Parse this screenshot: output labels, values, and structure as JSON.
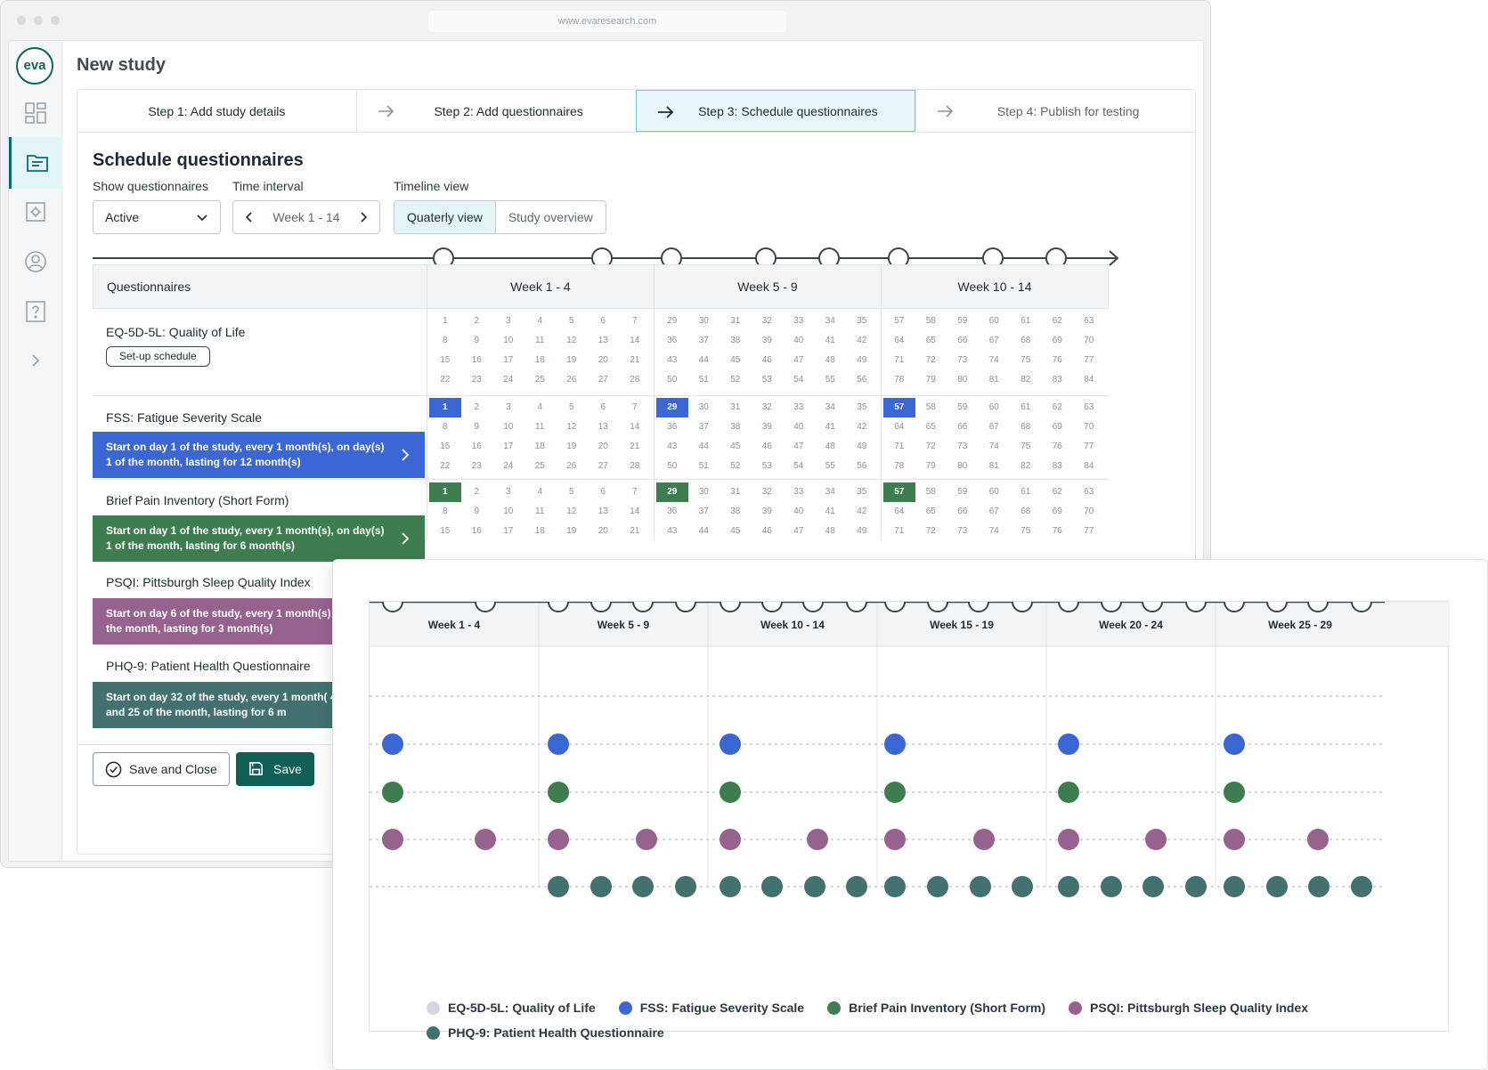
{
  "browser": {
    "url": "www.evaresearch.com"
  },
  "app": {
    "logo_text": "eva",
    "page_title": "New study"
  },
  "sidebar": {
    "items": [
      {
        "icon": "dashboard-icon"
      },
      {
        "icon": "folder-icon",
        "active": true
      },
      {
        "icon": "settings-icon"
      },
      {
        "icon": "user-icon"
      },
      {
        "icon": "help-icon"
      },
      {
        "icon": "expand-chevron-icon"
      }
    ]
  },
  "steps": [
    {
      "label": "Step 1: Add study details"
    },
    {
      "label": "Step 2: Add questionnaires"
    },
    {
      "label": "Step 3: Schedule questionnaires",
      "active": true
    },
    {
      "label": "Step 4: Publish for testing"
    }
  ],
  "schedule": {
    "title": "Schedule questionnaires",
    "show_label": "Show questionnaires",
    "show_value": "Active",
    "interval_label": "Time interval",
    "interval_value": "Week 1 - 14",
    "view_label": "Timeline view",
    "view_options": [
      "Quaterly view",
      "Study overview"
    ],
    "column_header": "Questionnaires",
    "week_groups": [
      "Week 1 - 4",
      "Week 5 - 9",
      "Week 10 - 14"
    ],
    "setup_button": "Set-up schedule",
    "questionnaires": [
      {
        "name": "EQ-5D-5L: Quality of Life",
        "schedule": ""
      },
      {
        "name": "FSS: Fatigue Severity Scale",
        "schedule": "Start on day 1 of the study, every 1 month(s), on day(s) 1 of the month, lasting for 12 month(s)"
      },
      {
        "name": "Brief Pain Inventory (Short Form)",
        "schedule": "Start on day 1 of the study, every 1 month(s), on day(s) 1 of the month, lasting for 6 month(s)"
      },
      {
        "name": "PSQI: Pittsburgh Sleep Quality Index",
        "schedule": "Start on day 6 of the study, every 1 month(s) and 20 of the month, lasting for 3 month(s)"
      },
      {
        "name": "PHQ-9: Patient Health Questionnaire",
        "schedule": "Start on day 32 of the study, every 1 month( 4, 11, 18 and 25 of the month, lasting for 6 m"
      }
    ],
    "calendar_rows": [
      {
        "visible_weeks": 4,
        "highlight": []
      },
      {
        "visible_weeks": 4,
        "highlight": [
          1,
          29,
          57
        ]
      },
      {
        "visible_weeks": 3,
        "highlight": [
          1,
          29,
          57
        ]
      }
    ]
  },
  "footer": {
    "save_close": "Save and Close",
    "save": "Save"
  },
  "overview": {
    "week_groups": [
      "Week 1 - 4",
      "Week 5 - 9",
      "Week 10 - 14",
      "Week 15 - 19",
      "Week 20 - 24",
      "Week 25 - 29"
    ],
    "legend": [
      {
        "label": "EQ-5D-5L: Quality of Life",
        "color": "#d5d9dd"
      },
      {
        "label": "FSS: Fatigue Severity Scale",
        "color": "#3b67d4"
      },
      {
        "label": "Brief Pain Inventory (Short Form)",
        "color": "#3d7d4f"
      },
      {
        "label": "PSQI: Pittsburgh Sleep Quality Index",
        "color": "#96638f"
      },
      {
        "label": "PHQ-9: Patient Health Questionnaire",
        "color": "#43716f"
      }
    ]
  },
  "colors": {
    "accent": "#10635c",
    "fss": "#3b67d4",
    "bpi": "#3d7d4f",
    "psqi": "#96638f",
    "phq": "#43716f",
    "eq": "#d5d9dd"
  }
}
